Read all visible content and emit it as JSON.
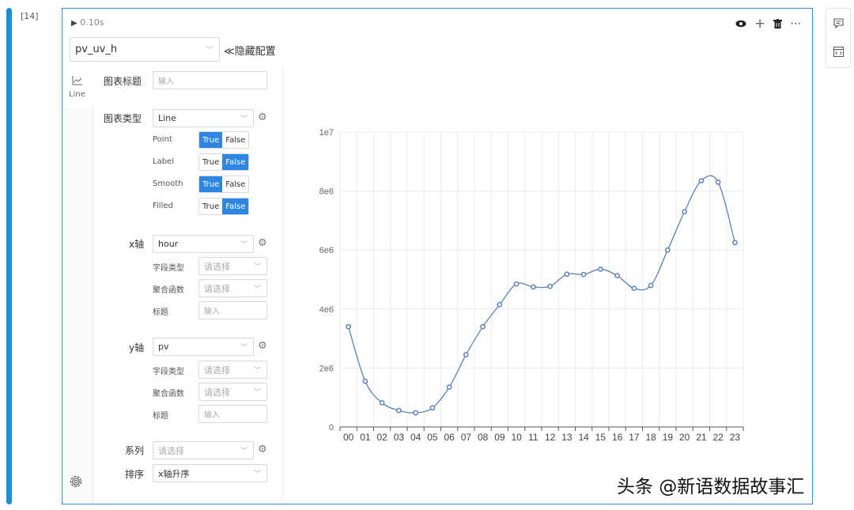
{
  "cell": {
    "number": "[14]",
    "run_time": "0.10s",
    "dataset_select": "pv_uv_h",
    "hide_config": "≪隐藏配置"
  },
  "toolbar": {
    "eye": "eye-icon",
    "add": "+",
    "delete": "trash-icon",
    "more": "⋯"
  },
  "sidebar_tab": {
    "label": "Line"
  },
  "config": {
    "title_label": "图表标题",
    "title_placeholder": "输入",
    "type_label": "图表类型",
    "type_value": "Line",
    "toggles": [
      {
        "name": "Point",
        "true": "True",
        "false": "False",
        "selected": "True"
      },
      {
        "name": "Label",
        "true": "True",
        "false": "False",
        "selected": "False"
      },
      {
        "name": "Smooth",
        "true": "True",
        "false": "False",
        "selected": "True"
      },
      {
        "name": "Filled",
        "true": "True",
        "false": "False",
        "selected": "False"
      }
    ],
    "x_label": "x轴",
    "x_value": "hour",
    "y_label": "y轴",
    "y_value": "pv",
    "field_type_label": "字段类型",
    "agg_label": "聚合函数",
    "axis_title_label": "标题",
    "select_placeholder": "请选择",
    "input_placeholder": "输入",
    "series_label": "系列",
    "series_placeholder": "请选择",
    "sort_label": "排序",
    "sort_value": "x轴升序"
  },
  "chart_data": {
    "type": "line",
    "smooth": true,
    "points": true,
    "color": "#5b82b5",
    "x": [
      "00",
      "01",
      "02",
      "03",
      "04",
      "05",
      "06",
      "07",
      "08",
      "09",
      "10",
      "11",
      "12",
      "13",
      "14",
      "15",
      "16",
      "17",
      "18",
      "19",
      "20",
      "21",
      "22",
      "23"
    ],
    "values": [
      3400000,
      1550000,
      820000,
      560000,
      480000,
      650000,
      1350000,
      2450000,
      3400000,
      4150000,
      4850000,
      4750000,
      4770000,
      5180000,
      5170000,
      5350000,
      5130000,
      4700000,
      4800000,
      6000000,
      7300000,
      8350000,
      8300000,
      6250000
    ],
    "ylim": [
      0,
      10000000
    ],
    "yticks": [
      "0",
      "2e6",
      "4e6",
      "6e6",
      "8e6",
      "1e7"
    ],
    "grid": true
  },
  "watermark": "头条 @新语数据故事汇"
}
